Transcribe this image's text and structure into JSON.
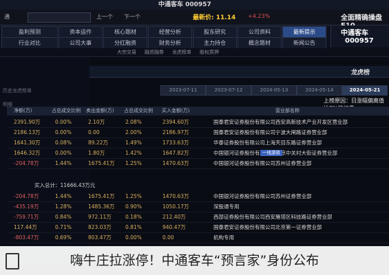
{
  "window": {
    "title": "中通客车 000957"
  },
  "topbar": {
    "code_label": "通",
    "mid_text": "最新价: 11.14",
    "pct": "+4.23%",
    "up_label": "上一个",
    "down_label": "下一个",
    "brand": "全面精确操盘 F10"
  },
  "nav": [
    {
      "label": "最新提示",
      "active": true
    },
    {
      "label": "公司资料",
      "active": false
    },
    {
      "label": "股东研究",
      "active": false
    },
    {
      "label": "经营分析",
      "active": false
    },
    {
      "label": "核心题材",
      "active": false
    },
    {
      "label": "资本运作",
      "active": false
    },
    {
      "label": "盈利预测",
      "active": false
    },
    {
      "label": "新闻公告",
      "active": false
    },
    {
      "label": "概念题材",
      "active": false
    },
    {
      "label": "主力持仓",
      "active": false
    },
    {
      "label": "财务分析",
      "active": false
    },
    {
      "label": "分红融资",
      "active": false
    },
    {
      "label": "公司大事",
      "active": false
    },
    {
      "label": "行业对比",
      "active": false
    }
  ],
  "stock": {
    "name": "中通客车",
    "code": "000957"
  },
  "subtabs": [
    "大宗交易",
    "融资融券",
    "龙虎榜单",
    "股权质押"
  ],
  "titlestrip": {
    "label": "龙虎榜"
  },
  "left_panel": {
    "label1": "历史龙虎榜单",
    "label2": "明细"
  },
  "date_tabs": [
    {
      "label": "2024-05-21",
      "active": true
    },
    {
      "label": "2024-05-14",
      "active": false
    },
    {
      "label": "2024-05-13",
      "active": false
    },
    {
      "label": "2023-07-12",
      "active": false
    },
    {
      "label": "2023-07-11",
      "active": false
    }
  ],
  "reason": {
    "text": "上榜原因：日涨幅偏离值达7%的证券"
  },
  "table": {
    "headers": [
      "营业部名称",
      "买入金额(万)",
      "占总成交比例",
      "卖出金额(万)",
      "占总成交比例",
      "净额(万)"
    ],
    "buy_rows": [
      {
        "name": "国泰君安证券股份有限公司西安高新技术产业开发区营业部",
        "buy": "2394.60万",
        "buy_pct": "2.08%",
        "sell": "2.10万",
        "sell_pct": "0.00%",
        "net": "2391.90万"
      },
      {
        "name": "国泰君安证券股份有限公司宁波大闸路证券营业部",
        "buy": "2186.97万",
        "buy_pct": "2.00%",
        "sell": "0.00",
        "sell_pct": "0.00%",
        "net": "2186.13万"
      },
      {
        "name": "华泰证券股份有限公司上海天目东路证券营业部",
        "buy": "1733.63万",
        "buy_pct": "1.49%",
        "sell": "89.22万",
        "sell_pct": "0.08%",
        "net": "1641.30万"
      },
      {
        "name": "中国银河证券股份有限公司北京中关村大街证券营业部",
        "buy": "1647.82万",
        "buy_pct": "1.42%",
        "sell": "1.80万",
        "sell_pct": "0.00%",
        "net": "1646.32万",
        "badge": "一线游资"
      },
      {
        "name": "中国银河证券股份有限公司苏州证券营业部",
        "buy": "1470.63万",
        "buy_pct": "1.25%",
        "sell": "1675.41万",
        "sell_pct": "1.44%",
        "net": "-204.78万"
      }
    ],
    "buy_total": "买入总计：11666.43万元",
    "sell_rows": [
      {
        "name": "中国银河证券股份有限公司苏州证券营业部",
        "buy": "1470.63万",
        "buy_pct": "1.25%",
        "sell": "1675.41万",
        "sell_pct": "1.44%",
        "net": "-204.78万"
      },
      {
        "name": "深股通专用",
        "buy": "1050.17万",
        "buy_pct": "0.90%",
        "sell": "1485.36万",
        "sell_pct": "1.28%",
        "net": "-435.19万"
      },
      {
        "name": "西部证券股份有限公司西安雁塔区科技路证券营业部",
        "buy": "212.40万",
        "buy_pct": "0.18%",
        "sell": "972.11万",
        "sell_pct": "0.84%",
        "net": "-759.71万"
      },
      {
        "name": "国泰君安证券股份有限公司北京第一证券营业部",
        "buy": "940.47万",
        "buy_pct": "0.81%",
        "sell": "823.03万",
        "sell_pct": "0.71%",
        "net": "117.44万"
      },
      {
        "name": "机构专用",
        "buy": "0.00",
        "buy_pct": "0.00%",
        "sell": "803.47万",
        "sell_pct": "0.69%",
        "net": "-803.47万"
      }
    ]
  },
  "caption": {
    "text": "嗨牛庄拉涨停！中通客车“预言家”身份公布"
  }
}
